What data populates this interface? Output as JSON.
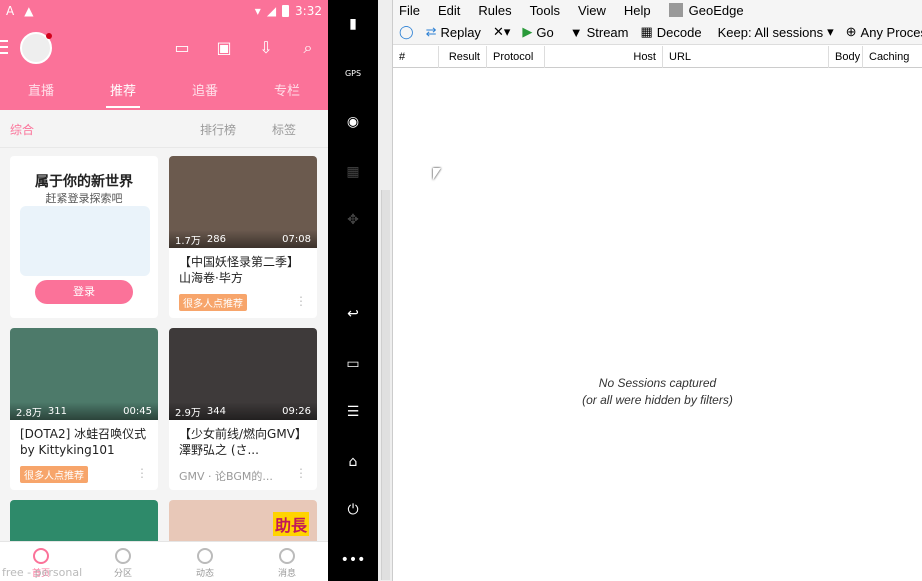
{
  "phone": {
    "statusbar": {
      "time": "3:32",
      "left_icons": [
        "A",
        "▲"
      ],
      "right_icons": [
        "▾",
        "◢"
      ]
    },
    "nav_tabs": [
      "直播",
      "推荐",
      "追番",
      "专栏"
    ],
    "subbar": {
      "left": "综合",
      "ranking": "排行榜",
      "tags": "标签"
    },
    "promo": {
      "title": "属于你的新世界",
      "subtitle": "赶紧登录探索吧",
      "login": "登录"
    },
    "cards": [
      {
        "views": "1.7万",
        "danmaku": "286",
        "duration": "07:08",
        "title": "【中国妖怪录第二季】山海卷·毕方",
        "tag": "很多人点推荐"
      },
      {
        "views": "2.8万",
        "danmaku": "311",
        "duration": "00:45",
        "title": "[DOTA2] 冰蛙召唤仪式by Kittyking101",
        "tag": "很多人点推荐"
      },
      {
        "views": "2.9万",
        "danmaku": "344",
        "duration": "09:26",
        "title": "【少女前线/燃向GMV】澤野弘之 (さ...",
        "source": "GMV · 论BGM的..."
      },
      {
        "overlay_text": "助長"
      }
    ],
    "bottom_nav": [
      "首页",
      "分区",
      "动态",
      "消息"
    ],
    "watermark": "free - personal"
  },
  "fiddler": {
    "menu": [
      "File",
      "Edit",
      "Rules",
      "Tools",
      "View",
      "Help"
    ],
    "geoedge": "GeoEdge",
    "toolbar": {
      "replay": "Replay",
      "go": "Go",
      "stream": "Stream",
      "decode": "Decode",
      "keep": "Keep: All sessions",
      "any_process": "Any Process"
    },
    "columns": [
      "#",
      "Result",
      "Protocol",
      "Host",
      "URL",
      "Body",
      "Caching"
    ],
    "empty_line1": "No Sessions captured",
    "empty_line2": "(or all were hidden by filters)"
  }
}
